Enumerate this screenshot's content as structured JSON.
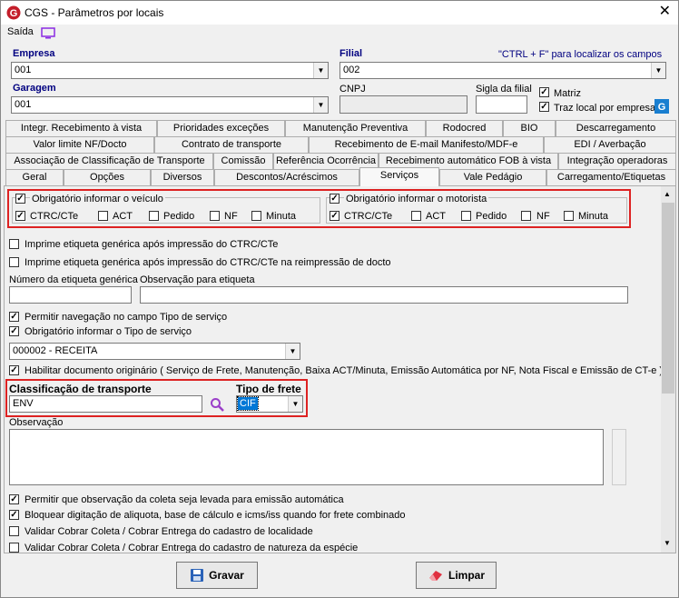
{
  "window": {
    "title": "CGS - Parâmetros por locais",
    "close": "✕"
  },
  "menu": {
    "saida": "Saída"
  },
  "header": {
    "empresa_label": "Empresa",
    "empresa_value": "001",
    "filial_label": "Filial",
    "filial_value": "002",
    "hint": "\"CTRL + F\" para localizar os campos",
    "garagem_label": "Garagem",
    "garagem_value": "001",
    "cnpj_label": "CNPJ",
    "cnpj_value": "",
    "sigla_label": "Sigla da filial",
    "sigla_value": "",
    "matriz_label": "Matriz",
    "traz_label": "Traz local por empresa"
  },
  "tabs": {
    "row1": [
      "Integr. Recebimento à vista",
      "Prioridades exceções",
      "Manutenção Preventiva",
      "Rodocred",
      "BIO",
      "Descarregamento"
    ],
    "row2": [
      "Valor limite NF/Docto",
      "Contrato de transporte",
      "Recebimento de E-mail Manifesto/MDF-e",
      "EDI / Averbação"
    ],
    "row3": [
      "Associação de Classificação de Transporte",
      "Comissão",
      "Referência Ocorrência",
      "Recebimento automático FOB à vista",
      "Integração operadoras"
    ],
    "row4": [
      "Geral",
      "Opções",
      "Diversos",
      "Descontos/Acréscimos",
      "Serviços",
      "Vale Pedágio",
      "Carregamento/Etiquetas"
    ]
  },
  "servicos": {
    "veiculo_title": "Obrigatório informar o veículo",
    "motorista_title": "Obrigatório informar o motorista",
    "doc_options": [
      "CTRC/CTe",
      "ACT",
      "Pedido",
      "NF",
      "Minuta"
    ],
    "imprime1": "Imprime etiqueta genérica após impressão do CTRC/CTe",
    "imprime2": "Imprime etiqueta genérica após impressão do CTRC/CTe na reimpressão de docto",
    "numero_label": "Número da etiqueta genérica",
    "obs_etiqueta_label": "Observação para etiqueta",
    "permitir_nav": "Permitir navegação no campo Tipo de serviço",
    "obrig_tipo": "Obrigatório informar o Tipo de serviço",
    "tipo_servico_value": "000002 - RECEITA",
    "habilitar_doc": "Habilitar documento originário ( Serviço de Frete, Manutenção, Baixa ACT/Minuta, Emissão Automática por NF, Nota Fiscal e Emissão de CT-e )",
    "class_label": "Classificação de transporte",
    "class_value": "ENV",
    "tipo_frete_label": "Tipo de frete",
    "tipo_frete_value": "CIF",
    "observacao_label": "Observação",
    "permitir_obs": "Permitir que observação da coleta seja levada para emissão automática",
    "bloquear": "Bloquear digitação de aliquota, base de cálculo e icms/iss quando for frete combinado",
    "validar1": "Validar Cobrar Coleta / Cobrar Entrega do cadastro de localidade",
    "validar2": "Validar Cobrar Coleta / Cobrar Entrega do cadastro de natureza da espécie"
  },
  "buttons": {
    "gravar": "Gravar",
    "limpar": "Limpar"
  },
  "colors": {
    "red_highlight": "#d22222",
    "selection": "#0078d7"
  }
}
